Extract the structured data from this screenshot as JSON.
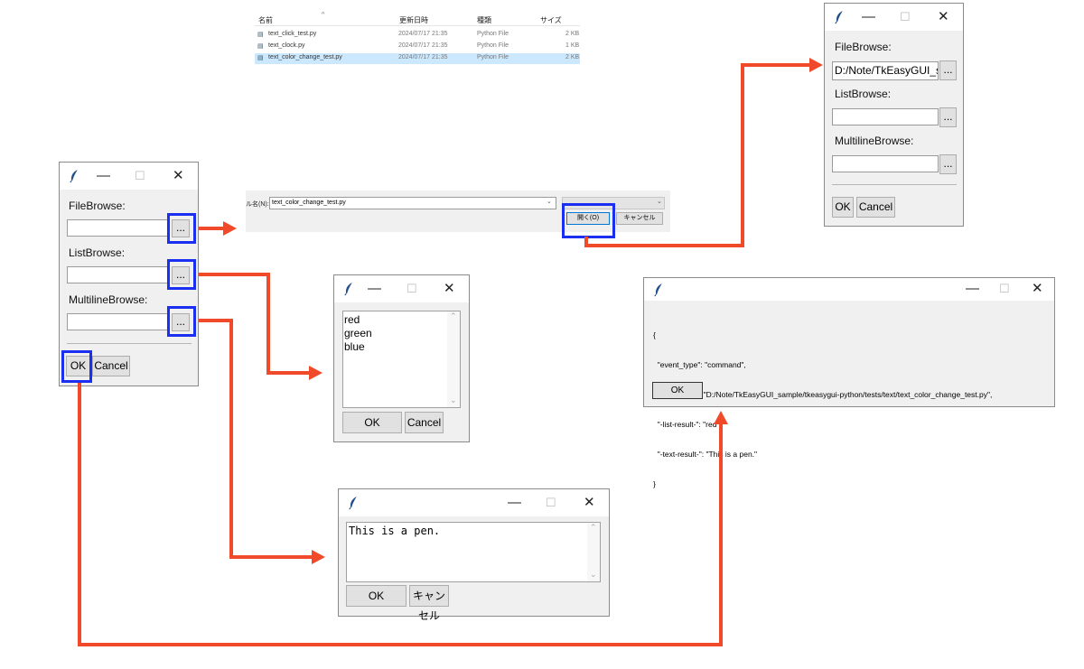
{
  "main_window": {
    "file_label": "FileBrowse:",
    "list_label": "ListBrowse:",
    "multi_label": "MultilineBrowse:",
    "browse_label": "...",
    "ok_label": "OK",
    "cancel_label": "Cancel"
  },
  "file_dialog": {
    "columns": [
      "名前",
      "更新日時",
      "種類",
      "サイズ"
    ],
    "files": [
      {
        "name": "text_click_test.py",
        "date": "2024/07/17 21:35",
        "type": "Python File",
        "size": "2 KB"
      },
      {
        "name": "text_clock.py",
        "date": "2024/07/17 21:35",
        "type": "Python File",
        "size": "1 KB"
      },
      {
        "name": "text_color_change_test.py",
        "date": "2024/07/17 21:35",
        "type": "Python File",
        "size": "2 KB"
      }
    ],
    "filename_label": "ル名(N):",
    "filename_value": "text_color_change_test.py",
    "open_label": "開く(O)",
    "cancel_label": "キャンセル"
  },
  "result_window": {
    "file_label": "FileBrowse:",
    "file_value": "D:/Note/TkEasyGUI_sar",
    "list_label": "ListBrowse:",
    "multi_label": "MultilineBrowse:",
    "browse_label": "...",
    "ok_label": "OK",
    "cancel_label": "Cancel"
  },
  "list_window": {
    "items": [
      "red",
      "green",
      "blue"
    ],
    "ok_label": "OK",
    "cancel_label": "Cancel"
  },
  "text_window": {
    "text_value": "This is a pen.",
    "ok_label": "OK",
    "cancel_label": "キャンセル"
  },
  "popup_window": {
    "lines": [
      "{",
      "  \"event_type\": \"command\",",
      "  \"-file-result-\": \"D:/Note/TkEasyGUI_sample/tkeasygui-python/tests/text/text_color_change_test.py\",",
      "  \"-list-result-\": \"red\",",
      "  \"-text-result-\": \"This is a pen.\"",
      "}"
    ],
    "ok_label": "OK"
  },
  "colors": {
    "arrow": "#f04a2a",
    "highlight": "#1a2ff0",
    "selected_row": "#cce8ff"
  }
}
